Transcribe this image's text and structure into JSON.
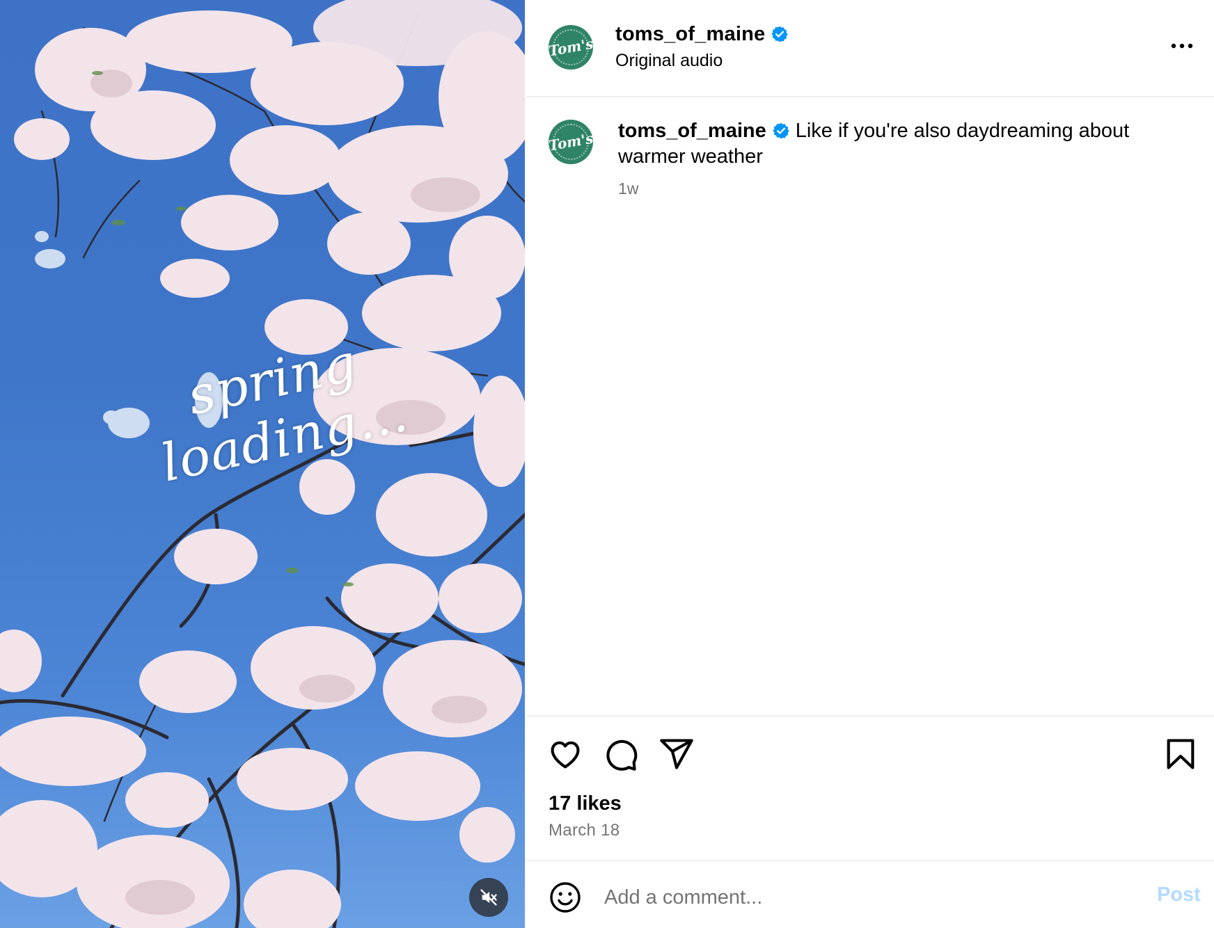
{
  "media": {
    "overlay_text": "spring loading...",
    "mute_icon": "speaker-muted-icon"
  },
  "header": {
    "avatar_text": "Tom's",
    "username": "toms_of_maine",
    "verified_icon": "verified-badge-icon",
    "audio_label": "Original audio",
    "more_icon": "more-horizontal-icon"
  },
  "caption": {
    "avatar_text": "Tom's",
    "username": "toms_of_maine",
    "text": "Like if you're also daydreaming about warmer weather",
    "time": "1w"
  },
  "actions": {
    "like_icon": "heart-icon",
    "comment_icon": "comment-icon",
    "share_icon": "share-icon",
    "save_icon": "bookmark-icon"
  },
  "stats": {
    "likes": "17 likes",
    "date": "March 18"
  },
  "comment_box": {
    "emoji_icon": "emoji-icon",
    "placeholder": "Add a comment...",
    "post_label": "Post"
  },
  "colors": {
    "brand": "#2f8468",
    "verified": "#0095f6",
    "post_disabled": "#b3dbff",
    "secondary_text": "#737373"
  }
}
